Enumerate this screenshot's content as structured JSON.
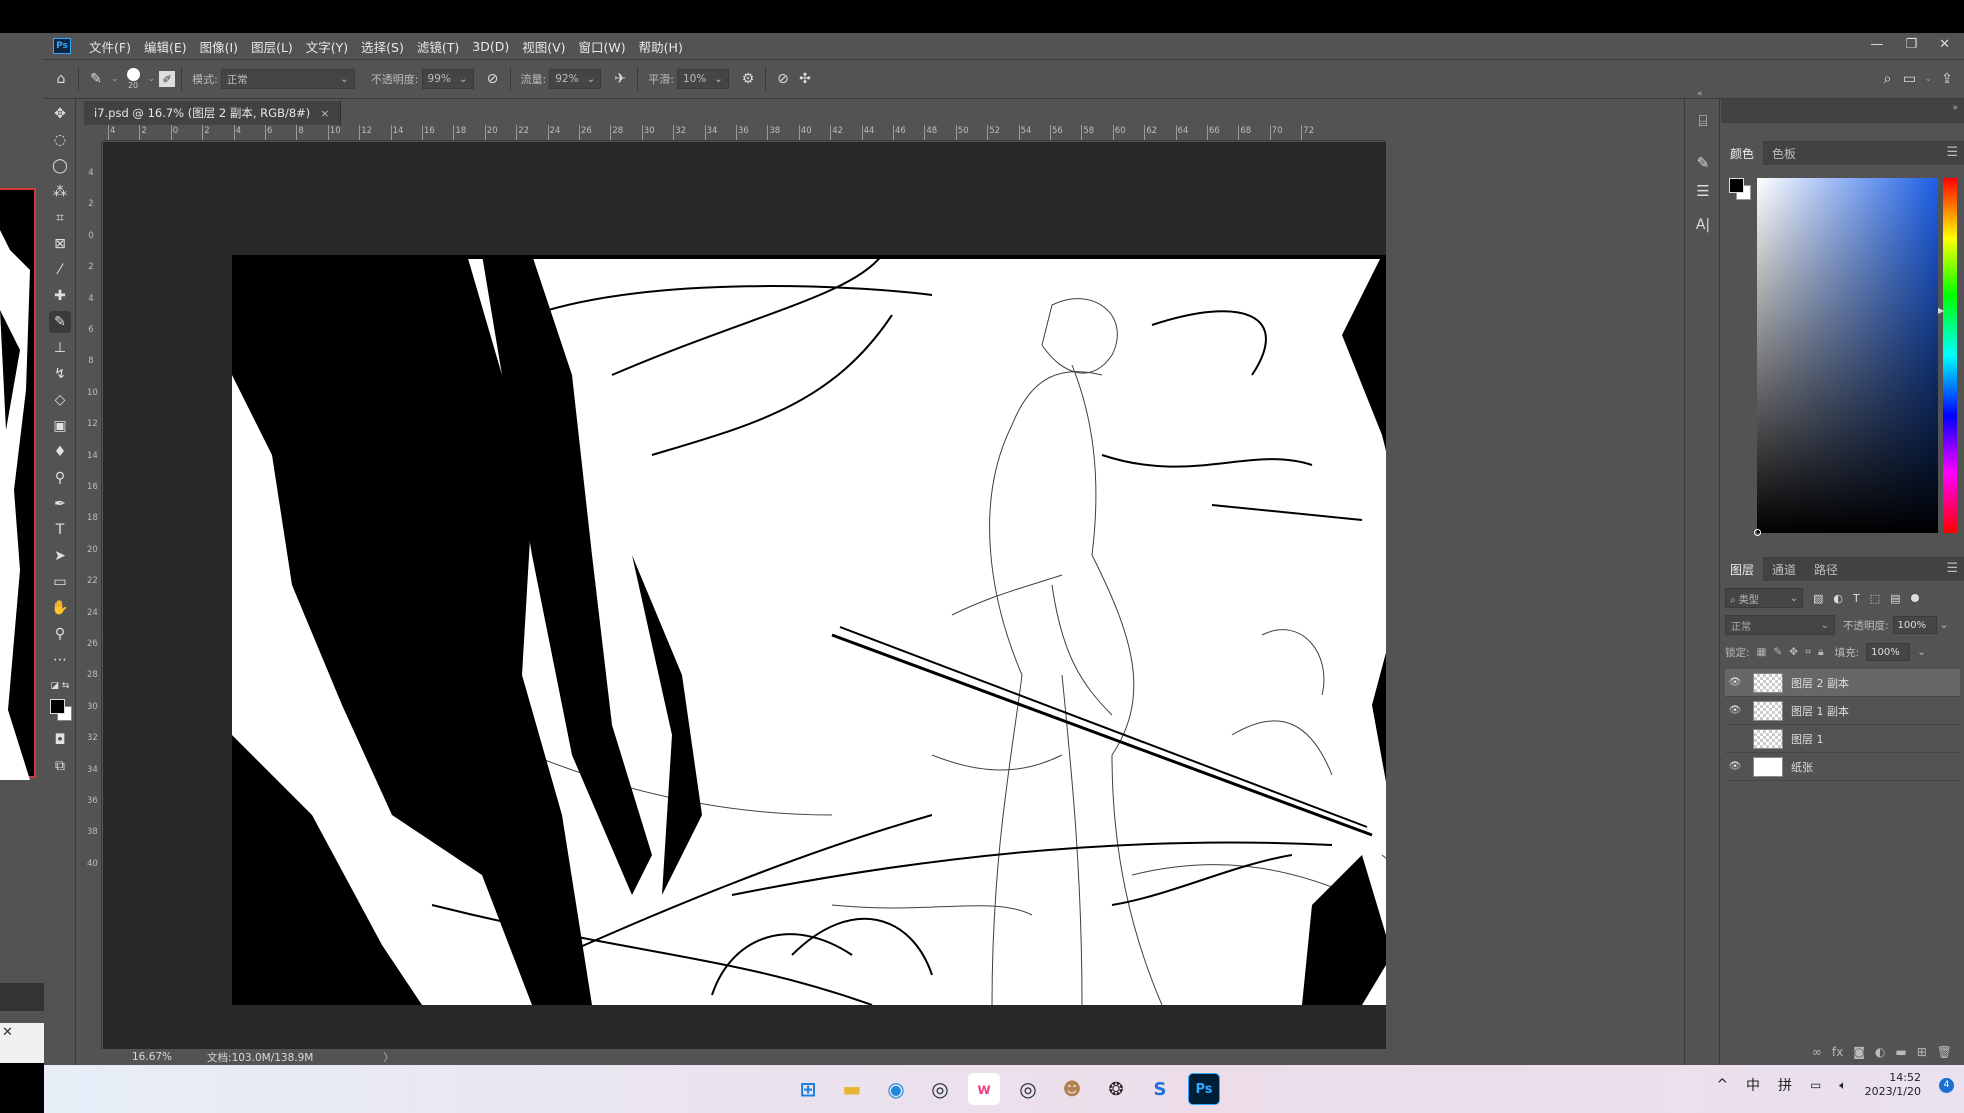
{
  "menu": [
    "文件(F)",
    "编辑(E)",
    "图像(I)",
    "图层(L)",
    "文字(Y)",
    "选择(S)",
    "滤镜(T)",
    "3D(D)",
    "视图(V)",
    "窗口(W)",
    "帮助(H)"
  ],
  "app_logo": "Ps",
  "options": {
    "brush_size": "20",
    "mode_label": "模式:",
    "mode_value": "正常",
    "opacity_label": "不透明度:",
    "opacity_value": "99%",
    "flow_label": "流量:",
    "flow_value": "92%",
    "smoothing_label": "平滑:",
    "smoothing_value": "10%"
  },
  "document_tab": {
    "title": "i7.psd @ 16.7% (图层 2 副本, RGB/8#)",
    "close": "×"
  },
  "ruler_top": [
    "4",
    "2",
    "0",
    "2",
    "4",
    "6",
    "8",
    "10",
    "12",
    "14",
    "16",
    "18",
    "20",
    "22",
    "24",
    "26",
    "28",
    "30",
    "32",
    "34",
    "36",
    "38",
    "40",
    "42",
    "44",
    "46",
    "48",
    "50",
    "52",
    "54",
    "56",
    "58",
    "60",
    "62",
    "64",
    "66",
    "68",
    "70",
    "72"
  ],
  "ruler_left": [
    "4",
    "2",
    "0",
    "2",
    "4",
    "6",
    "8",
    "10",
    "12",
    "14",
    "16",
    "18",
    "20",
    "22",
    "24",
    "26",
    "28",
    "30",
    "32",
    "34",
    "36",
    "38",
    "40"
  ],
  "status": {
    "zoom": "16.67%",
    "doc": "文档:103.0M/138.9M",
    "arrow": "〉"
  },
  "color_panel": {
    "tabs": [
      "颜色",
      "色板"
    ],
    "fg_color": "#000000",
    "bg_color": "#ffffff"
  },
  "layers_panel": {
    "tabs": [
      "图层",
      "通道",
      "路径"
    ],
    "kind_label": "类型",
    "blend_mode": "正常",
    "opacity_label": "不透明度:",
    "opacity_value": "100%",
    "lock_label": "锁定:",
    "fill_label": "填充:",
    "fill_value": "100%",
    "layers": [
      {
        "name": "图层 2 副本",
        "visible": true,
        "selected": true
      },
      {
        "name": "图层 1 副本",
        "visible": true,
        "selected": false
      },
      {
        "name": "图层 1",
        "visible": false,
        "selected": false
      },
      {
        "name": "纸张",
        "visible": true,
        "selected": false
      }
    ]
  },
  "taskbar": {
    "ime_mode": "中",
    "ime_input": "拼",
    "time": "14:52",
    "date": "2023/1/20",
    "notification_count": "4"
  }
}
